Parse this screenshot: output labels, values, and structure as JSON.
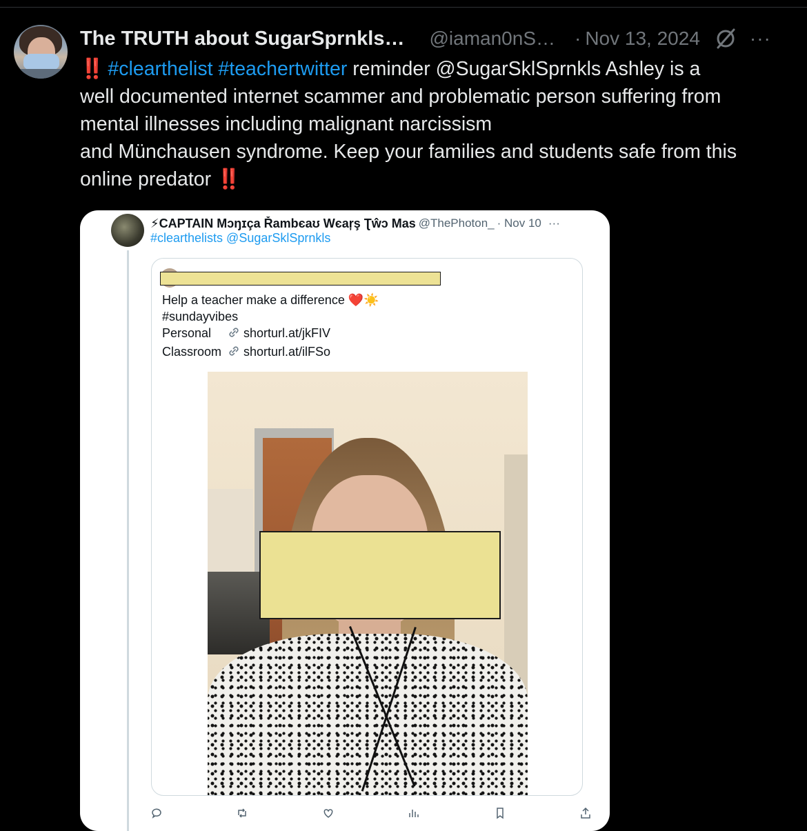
{
  "tweet": {
    "display_name": "The TRUTH about SugarSprnkls…",
    "handle": "@iaman0nS…",
    "separator": "·",
    "date": "Nov 13, 2024",
    "grok_icon": "grok-slash-icon",
    "more_icon": "more-horizontal-icon",
    "body": {
      "line1_emoji": "‼️",
      "line1_tag1": "#clearthelist",
      "line1_tag2": "#teachertwitter",
      "line1_rest": " reminder  @SugarSklSprnkls Ashley is a",
      "line2": "well documented internet scammer and problematic person suffering from",
      "line3": "mental illnesses including malignant narcissism",
      "line4": "and Münchausen syndrome. Keep your families and students safe from this",
      "line5_text": "online predator",
      "line5_emoji": "‼️"
    }
  },
  "embedded": {
    "name": "⚡CAPTAIN Mɔŋɪça Řambєaʊ Wєaŗş Ʈŵɔ Mas",
    "handle": "@ThePhoton_",
    "date": "· Nov 10",
    "more": "···",
    "tags": "#clearthelists @SugarSklSprnkls",
    "quote": {
      "line1": "Help a teacher make a difference ❤️☀️",
      "line2": "#sundayvibes",
      "personal_label": "Personal",
      "personal_link": "shorturl.at/jkFIV",
      "classroom_label": "Classroom",
      "classroom_link": "shorturl.at/ilFSo"
    },
    "actions": [
      "reply-icon",
      "retweet-icon",
      "like-icon",
      "views-icon",
      "bookmark-icon",
      "share-icon"
    ]
  },
  "colors": {
    "background": "#000000",
    "link_blue": "#1d9bf0",
    "muted_text": "#71767b",
    "redaction_yellow": "#ebe193"
  }
}
